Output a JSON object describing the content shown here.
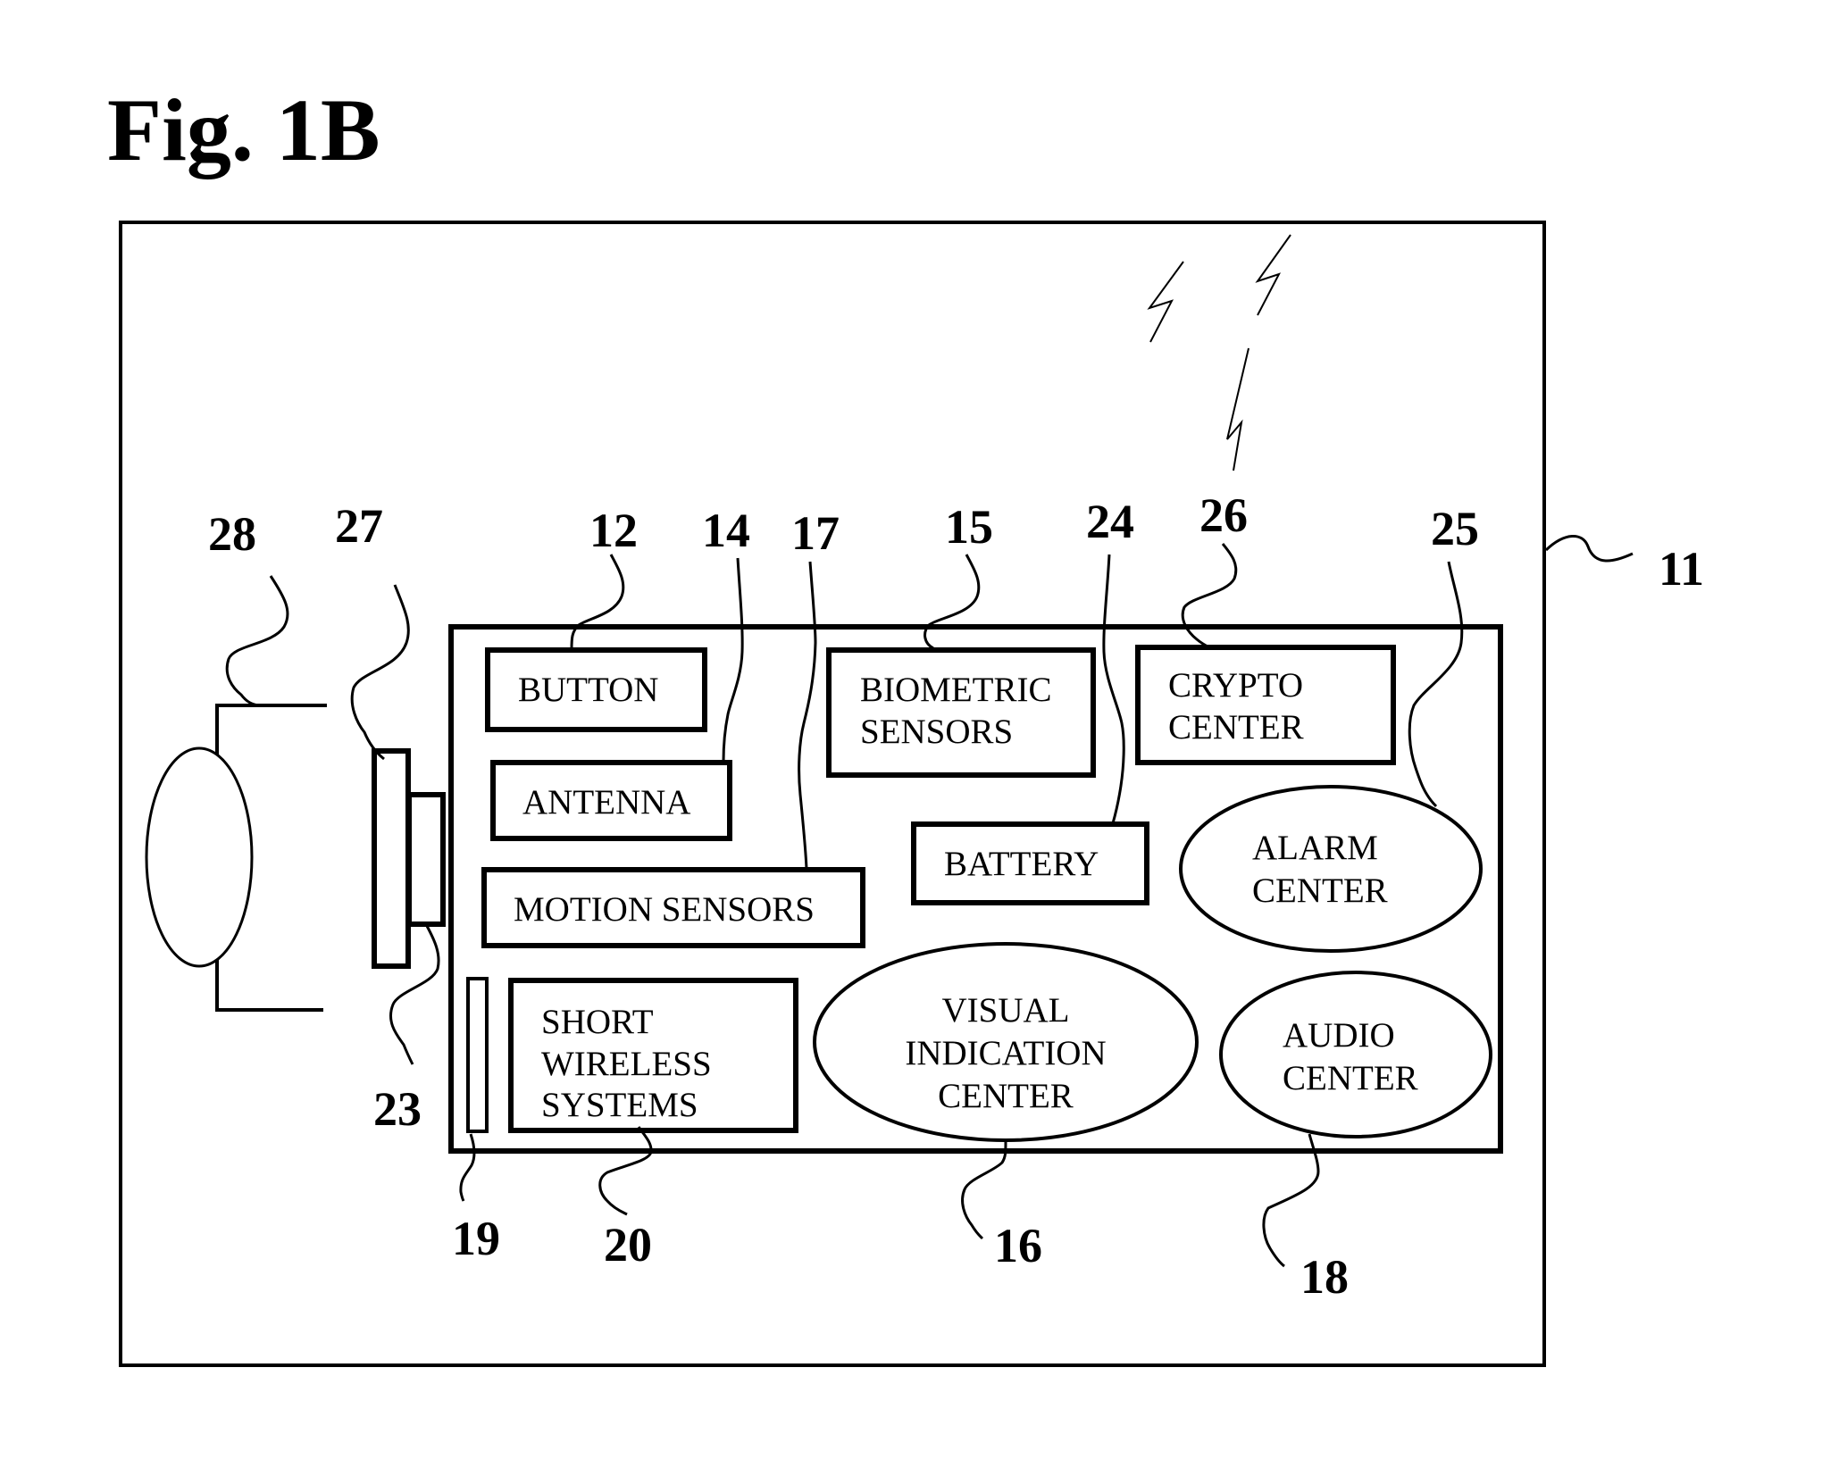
{
  "figure": {
    "title": "Fig. 1B"
  },
  "components": {
    "button": {
      "lines": [
        "BUTTON"
      ],
      "ref": "12"
    },
    "antenna": {
      "lines": [
        "ANTENNA"
      ],
      "ref": "14"
    },
    "motion_sensors": {
      "lines": [
        "MOTION SENSORS"
      ],
      "ref": "17"
    },
    "biometric_sensors": {
      "lines": [
        "BIOMETRIC",
        "SENSORS"
      ],
      "ref": "15"
    },
    "battery": {
      "lines": [
        "BATTERY"
      ],
      "ref": "24"
    },
    "crypto_center": {
      "lines": [
        "CRYPTO",
        "CENTER"
      ],
      "ref": "26"
    },
    "alarm_center": {
      "lines": [
        "ALARM",
        "CENTER"
      ],
      "ref": "25"
    },
    "short_wireless_systems": {
      "lines": [
        "SHORT",
        "WIRELESS",
        "SYSTEMS"
      ],
      "ref": "20"
    },
    "visual_indication_center": {
      "lines": [
        "VISUAL",
        "INDICATION",
        "CENTER"
      ],
      "ref": "16"
    },
    "audio_center": {
      "lines": [
        "AUDIO",
        "CENTER"
      ],
      "ref": "18"
    }
  },
  "other_refs": {
    "device_enclosure": "11",
    "side_strip": "19",
    "connector": "23",
    "mount_plate": "27",
    "strap_loop": "28"
  }
}
